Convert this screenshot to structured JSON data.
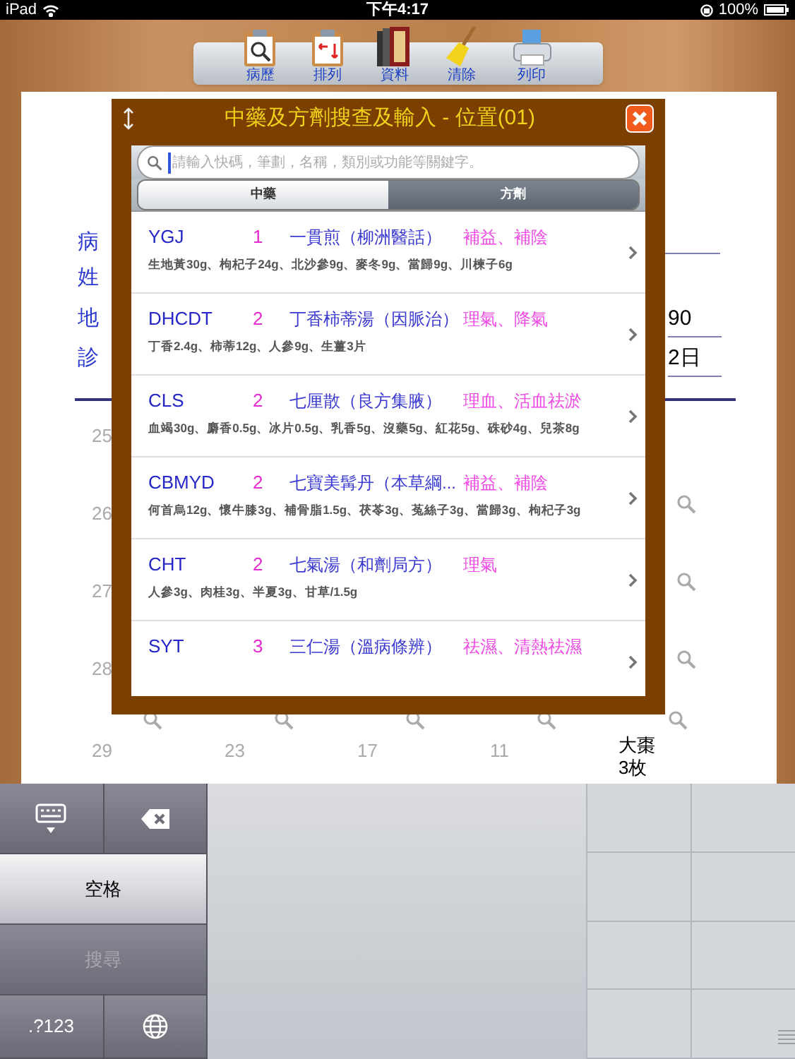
{
  "status_bar": {
    "device": "iPad",
    "time": "下午4:17",
    "battery": "100%"
  },
  "toolbar": [
    {
      "label": "病歷",
      "kind": "clipboard-search"
    },
    {
      "label": "排列",
      "kind": "clipboard-sort"
    },
    {
      "label": "資料",
      "kind": "books"
    },
    {
      "label": "清除",
      "kind": "broom"
    },
    {
      "label": "列印",
      "kind": "printer"
    }
  ],
  "form": {
    "labels": [
      "病",
      "姓",
      "地",
      "診"
    ],
    "values": [
      "90",
      "2日"
    ]
  },
  "grid": {
    "left_numbers": [
      "25",
      "26",
      "27",
      "28"
    ],
    "bottom_numbers": [
      "29",
      "23",
      "17",
      "11"
    ],
    "last_cell": [
      "大棗",
      "3枚"
    ]
  },
  "dialog": {
    "title": "中藥及方劑搜查及輸入 - 位置(01)",
    "search": {
      "placeholder": "請輸入快碼，筆劃，名稱，類別或功能等關鍵字。"
    },
    "segments": [
      {
        "label": "中藥",
        "selected": false
      },
      {
        "label": "方劑",
        "selected": true
      }
    ],
    "items": [
      {
        "code": "YGJ",
        "grade": "1",
        "name": "一貫煎（柳洲醫話）",
        "category": "補益、補陰",
        "ingredients": "生地黃30g、枸杞子24g、北沙參9g、麥冬9g、當歸9g、川楝子6g"
      },
      {
        "code": "DHCDT",
        "grade": "2",
        "name": "丁香柿蒂湯（因脈治）",
        "category": "理氣、降氣",
        "ingredients": "丁香2.4g、柿蒂12g、人參9g、生薑3片"
      },
      {
        "code": "CLS",
        "grade": "2",
        "name": "七厘散（良方集腋）",
        "category": "理血、活血祛淤",
        "ingredients": "血竭30g、麝香0.5g、冰片0.5g、乳香5g、沒藥5g、紅花5g、硃砂4g、兒茶8g"
      },
      {
        "code": "CBMYD",
        "grade": "2",
        "name": "七寶美髯丹（本草綱...",
        "category": "補益、補陰",
        "ingredients": "何首烏12g、懷牛膝3g、補骨脂1.5g、茯苓3g、菟絲子3g、當歸3g、枸杞子3g"
      },
      {
        "code": "CHT",
        "grade": "2",
        "name": "七氣湯（和劑局方）",
        "category": "理氣",
        "ingredients": "人參3g、肉桂3g、半夏3g、甘草/1.5g"
      },
      {
        "code": "SYT",
        "grade": "3",
        "name": "三仁湯（溫病條辨）",
        "category": "祛濕、清熱祛濕"
      }
    ]
  },
  "keyboard": {
    "keys": [
      {
        "kind": "hide"
      },
      {
        "kind": "delete"
      },
      {
        "kind": "space",
        "label": "空格"
      },
      {
        "kind": "search",
        "label": "搜尋",
        "disabled": true
      },
      {
        "kind": "text",
        "label": ".?123"
      },
      {
        "kind": "globe"
      }
    ]
  }
}
